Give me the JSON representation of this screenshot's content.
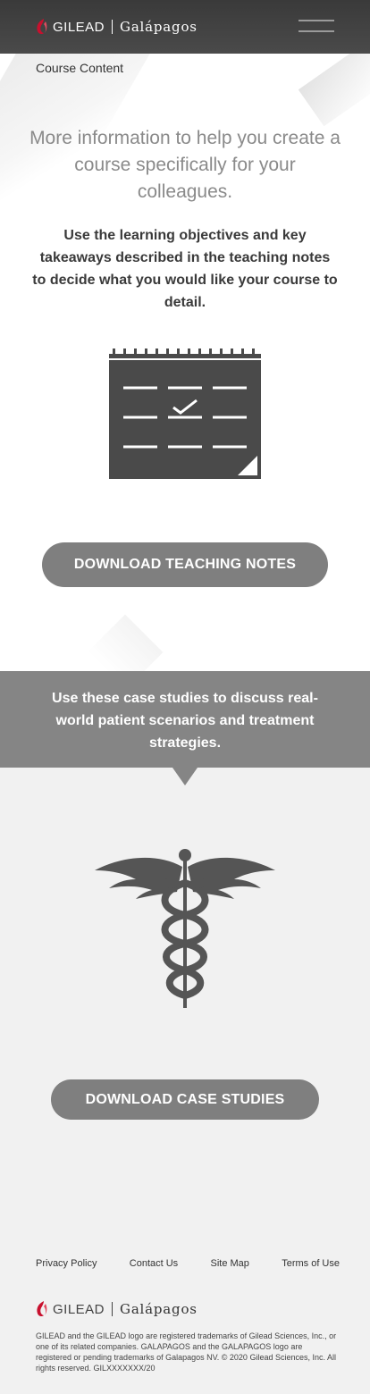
{
  "header": {
    "brand_primary": "GILEAD",
    "brand_secondary": "Galápagos",
    "menu_icon": "hamburger-menu-icon"
  },
  "course": {
    "section_label": "Course Content",
    "heading": "More information to help you create a course specifically for your colleagues.",
    "body": "Use the learning objectives and key takeaways described in the teaching notes to decide what you would like your course to detail.",
    "icon": "calendar-checklist-icon",
    "download_button": "DOWNLOAD TEACHING NOTES"
  },
  "case_studies": {
    "callout": "Use these case studies to discuss real-world patient scenarios and treatment strategies.",
    "icon": "caduceus-icon",
    "download_button": "DOWNLOAD CASE STUDIES"
  },
  "footer": {
    "links": [
      "Privacy Policy",
      "Contact Us",
      "Site Map",
      "Terms of Use"
    ],
    "brand_primary": "GILEAD",
    "brand_secondary": "Galápagos",
    "legal": "GILEAD and the GILEAD logo are registered trademarks of Gilead Sciences, Inc., or one of its related companies. GALAPAGOS and the GALAPAGOS logo are registered or pending trademarks of Galapagos NV. © 2020 Gilead Sciences, Inc. All rights reserved. GILXXXXXXX/20"
  },
  "colors": {
    "header_bg": "#3f3f3f",
    "gilead_red": "#c8102e",
    "button_gray": "#7f7f7f",
    "icon_dark": "#4a4a4a",
    "heading_gray": "#8a8a8a",
    "callout_gray": "#858585",
    "page_bg": "#f1f1f1"
  }
}
